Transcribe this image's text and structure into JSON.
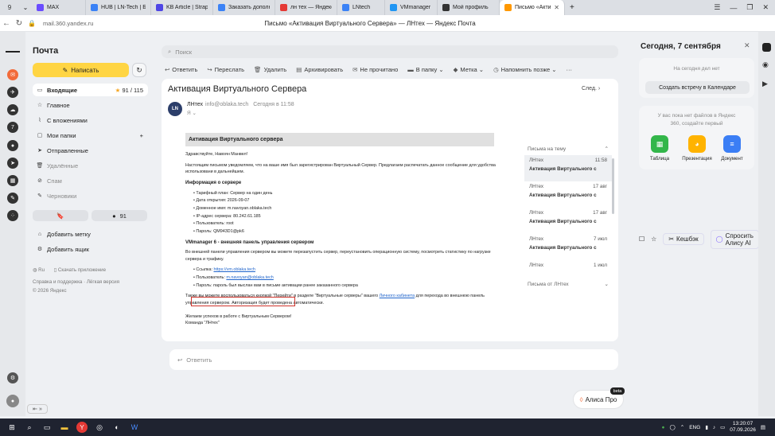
{
  "tabs": [
    {
      "label": "MAX",
      "color": "#6a4cff"
    },
    {
      "label": "HUB | LN-Tech | Базы",
      "color": "#3b82f6"
    },
    {
      "label": "KB Article | Strapi",
      "color": "#4f46e5"
    },
    {
      "label": "Заказать дополните",
      "color": "#3b82f6"
    },
    {
      "label": "лн тех — Яндекс: на",
      "color": "#e53935"
    },
    {
      "label": "LNtech",
      "color": "#3b82f6"
    },
    {
      "label": "VMmanager",
      "color": "#2196f3"
    },
    {
      "label": "Мой профиль",
      "color": "#333333"
    },
    {
      "label": "Письмо «Активац",
      "color": "#ff9800"
    }
  ],
  "tab_count": "9",
  "address": {
    "url": "mail.360.yandex.ru",
    "title": "Письмо «Активация Виртуального Сервера» — ЛНтех — Яндекс Почта",
    "cashback": "Кешбэк",
    "ask": "Спросить Алису AI"
  },
  "sidebar": {
    "title": "Почта",
    "compose": "Написать",
    "folders": [
      {
        "label": "Входящие",
        "count": "91 / 115"
      },
      {
        "label": "Главное"
      },
      {
        "label": "С вложениями"
      },
      {
        "label": "Мои папки"
      },
      {
        "label": "Отправленные"
      },
      {
        "label": "Удалённые"
      },
      {
        "label": "Спам"
      },
      {
        "label": "Черновики"
      }
    ],
    "unread": "91",
    "add_label": "Добавить метку",
    "add_box": "Добавить ящик",
    "lang": "Ru",
    "app": "Скачать приложение",
    "support": "Справка и поддержка · Лёгкая версия",
    "copyright": "© 2026 Яндекс"
  },
  "search": {
    "placeholder": "Поиск"
  },
  "toolbar": [
    "Ответить",
    "Переслать",
    "Удалить",
    "Архивировать",
    "Не прочитано",
    "В папку",
    "Метка",
    "Напомнить позже"
  ],
  "letter": {
    "subject": "Активация Виртуального Сервера",
    "next": "След.",
    "avatar": "LN",
    "sender": "ЛНтех",
    "email": "info@oblaka.tech",
    "date": "Сегодня в 11:58",
    "to": "Я",
    "header": "Активация Виртуального сервера",
    "greeting": "Здравствуйте, Навоян Манвел!",
    "intro": "Настоящим письмом уведомляем, что на ваше имя был зарегистрирован Виртуальный Сервер. Предлагаем распечатать данное сообщение для удобства использовани в дальнейшем.",
    "info_title": "Информация о сервере",
    "info": [
      "Тарифный план: Сервер на один день",
      "Дата открытия: 2026-09-07",
      "Доменное имя: m.navoyan.oblaka.tech",
      "IP-адрес сервера: 80.242.61.185",
      "Пользователь: root",
      "Пароль: QM943D1@pk6"
    ],
    "vm_title": "VMmanager 6 - внешняя панель управления сервером",
    "vm_text": "Во внешней панели управления сервером вы можете перезапустить сервер, переустановить операционную систему, посмотреть статистику по нагрузке сервера и трафику.",
    "vm_link_label": "Ссылка: ",
    "vm_link": "https://vm.oblaka.tech",
    "vm_user_label": "Пользователь: ",
    "vm_user": "m.navoyan@oblaka.tech",
    "vm_pass": "Пароль: пароль был выслан вам в письме активации ранее заказанного сервера",
    "extra_a": "Также вы можете воспользоваться кнопкой \"Перейти\" в разделе \"Виртуальные серверы\" вашего ",
    "extra_link": "Личного кабинета",
    "extra_b": " для перехода во внешнюю панель управления сервером. Авторизация будет проведена автоматически.",
    "bye": "Желаем успехов в работе с Виртуальным Сервером!",
    "team": "Команда \"ЛНтех\""
  },
  "thread": {
    "title": "Письма на тему",
    "items": [
      {
        "from": "ЛНтех",
        "date": "11:58",
        "subject": "Активация Виртуального с"
      },
      {
        "from": "ЛНтех",
        "date": "17 авг",
        "subject": "Активация Виртуального с"
      },
      {
        "from": "ЛНтех",
        "date": "17 авг",
        "subject": "Активация Виртуального с"
      },
      {
        "from": "ЛНтех",
        "date": "7 июл",
        "subject": "Активация Виртуального с"
      },
      {
        "from": "ЛНтех",
        "date": "1 июл",
        "subject": ""
      }
    ],
    "more": "Письма от ЛНтех"
  },
  "reply": "Ответить",
  "right": {
    "date": "Сегодня, 7 сентября",
    "no_events": "На сегодня дел нет",
    "create": "Создать встречу в Календаре",
    "no_files": "У вас пока нет файлов в Яндекс 360, создайте первый",
    "apps": [
      {
        "label": "Таблица",
        "color": "#33b64a"
      },
      {
        "label": "Презентация",
        "color": "#ffb300"
      },
      {
        "label": "Документ",
        "color": "#3b7ef5"
      }
    ]
  },
  "alice": {
    "label": "Алиса Про",
    "beta": "beta"
  },
  "taskbar": {
    "lang": "ENG",
    "time": "13:20:07",
    "date": "07.09.2026"
  }
}
